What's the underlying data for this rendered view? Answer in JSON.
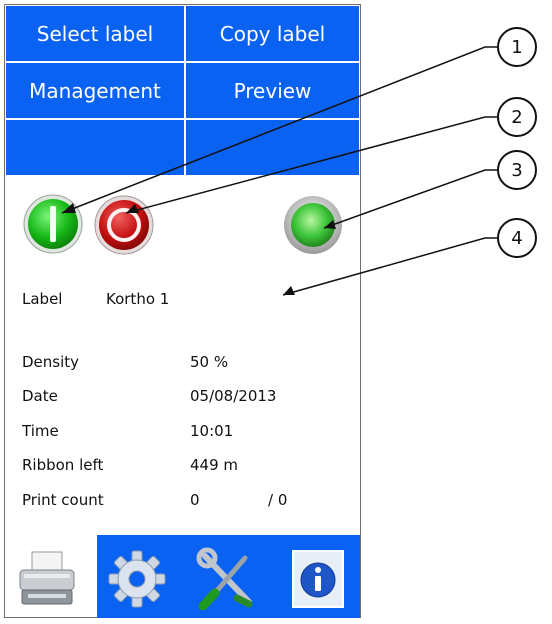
{
  "menu": {
    "select_label": "Select label",
    "copy_label": "Copy label",
    "management": "Management",
    "preview": "Preview"
  },
  "status": {
    "start_button": "start-icon",
    "stop_button": "stop-icon",
    "status_led": "green-led-icon"
  },
  "label_row": {
    "key": "Label",
    "value": "Kortho 1"
  },
  "info": [
    {
      "key": "Density",
      "value": "50 %"
    },
    {
      "key": "Date",
      "value": "05/08/2013"
    },
    {
      "key": "Time",
      "value": "10:01"
    },
    {
      "key": "Ribbon left",
      "value": "449 m"
    },
    {
      "key": "Print count",
      "value": "0",
      "extra": "/ 0"
    }
  ],
  "toolbar": {
    "printer": "printer-icon",
    "settings": "gear-icon",
    "tools": "tools-icon",
    "info": "info-icon"
  },
  "callouts": [
    "1",
    "2",
    "3",
    "4"
  ],
  "colors": {
    "menu_blue": "#0a62f2",
    "green": "#1fbf1f",
    "red": "#c40f0f"
  }
}
